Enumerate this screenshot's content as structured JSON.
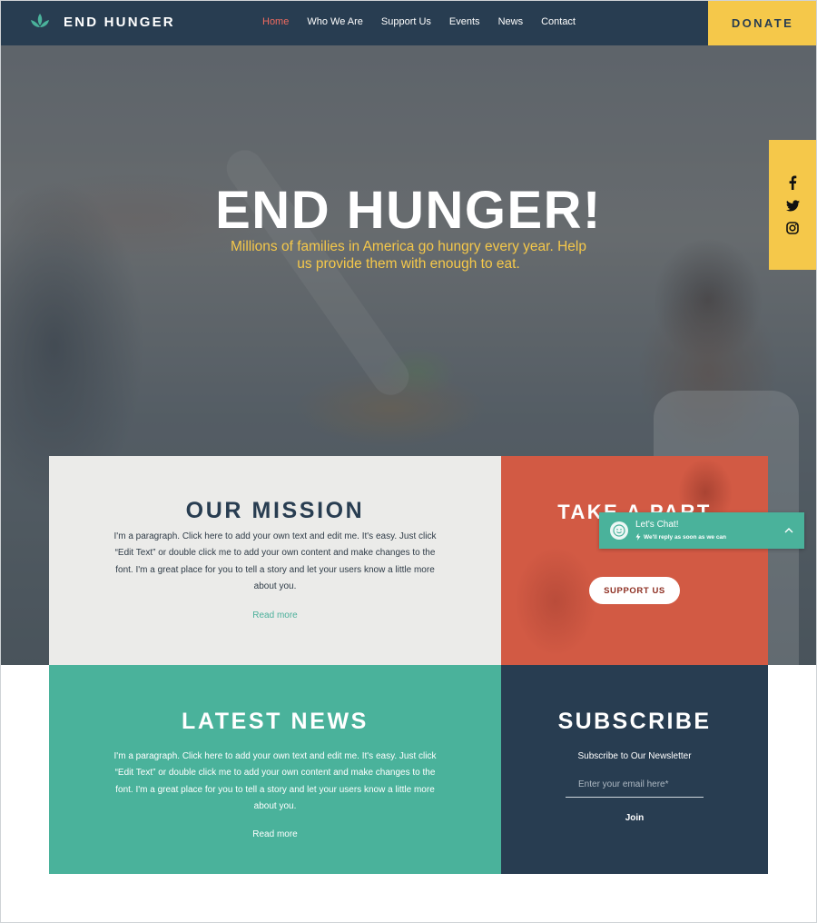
{
  "header": {
    "brand": "END HUNGER",
    "nav": [
      "Home",
      "Who We Are",
      "Support Us",
      "Events",
      "News",
      "Contact"
    ],
    "active_nav": "Home",
    "donate_label": "DONATE"
  },
  "hero": {
    "title": "END HUNGER!",
    "subtitle": "Millions of families in America go hungry every year. Help us provide them with enough to eat."
  },
  "social": {
    "icons": [
      "facebook-icon",
      "twitter-icon",
      "instagram-icon"
    ]
  },
  "mission": {
    "title": "OUR MISSION",
    "paragraph": "I'm a paragraph. Click here to add your own text and edit me. It's easy. Just click “Edit Text” or double click me to add your own content and make changes to the font. I'm a great place for you to tell a story and let your users know a little more about you.",
    "read_more": "Read more"
  },
  "action": {
    "title": "TAKE A PART",
    "button_label": "SUPPORT US"
  },
  "news": {
    "title": "LATEST NEWS",
    "paragraph": "I'm a paragraph. Click here to add your own text and edit me. It's easy. Just click “Edit Text” or double click me to add your own content and make changes to the font. I'm a great place for you to tell a story and let your users know a little more about you.",
    "read_more": "Read more"
  },
  "subscribe": {
    "title": "SUBSCRIBE",
    "label": "Subscribe to Our Newsletter",
    "email_placeholder": "Enter your email here*",
    "email_value": "",
    "join_label": "Join"
  },
  "chat": {
    "title": "Let's Chat!",
    "subtitle": "We'll reply as soon as we can"
  },
  "colors": {
    "navy": "#283d51",
    "yellow": "#f5c84a",
    "teal": "#4ab29b",
    "coral": "#d25a44",
    "light_gray": "#ebebe9",
    "active_nav": "#f06b5f"
  }
}
